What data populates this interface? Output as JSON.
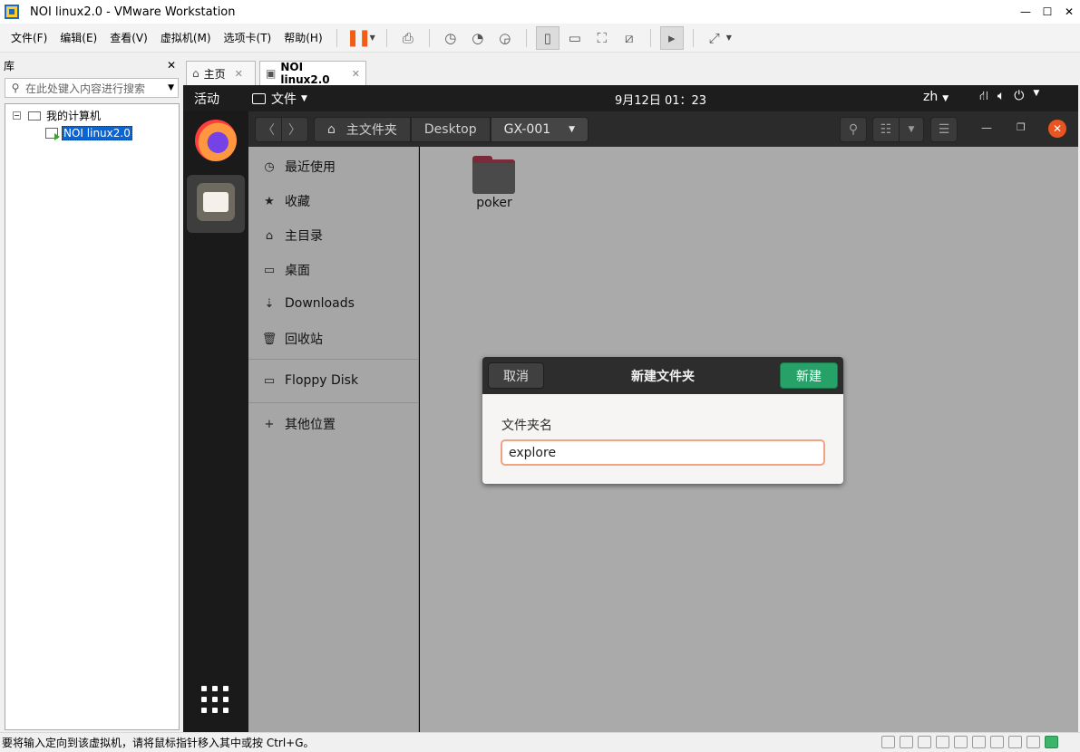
{
  "window": {
    "title": "NOI linux2.0 - VMware Workstation",
    "minimize": "—",
    "maximize": "☐",
    "close": "✕"
  },
  "menubar": {
    "items": [
      "文件(F)",
      "编辑(E)",
      "查看(V)",
      "虚拟机(M)",
      "选项卡(T)",
      "帮助(H)"
    ]
  },
  "library": {
    "title": "库",
    "close": "✕",
    "search_placeholder": "在此处键入内容进行搜索",
    "tree": {
      "root": "我的计算机",
      "vm": "NOI linux2.0",
      "expander": "−"
    }
  },
  "tabs": [
    {
      "label": "主页",
      "close": "✕"
    },
    {
      "label": "NOI linux2.0",
      "close": "✕"
    }
  ],
  "guest": {
    "topbar": {
      "activities": "活动",
      "app_menu": "文件",
      "clock": "9月12日  01：23",
      "lang": "zh"
    },
    "nautilus": {
      "path": [
        "主文件夹",
        "Desktop",
        "GX-001"
      ],
      "sidebar": [
        "最近使用",
        "收藏",
        "主目录",
        "桌面",
        "Downloads",
        "回收站",
        "Floppy Disk",
        "其他位置"
      ],
      "files": [
        {
          "name": "poker",
          "type": "folder"
        }
      ]
    },
    "dialog": {
      "title": "新建文件夹",
      "cancel": "取消",
      "create": "新建",
      "field_label": "文件夹名",
      "field_value": "explore"
    }
  },
  "status": {
    "message": "要将输入定向到该虚拟机，请将鼠标指针移入其中或按 Ctrl+G。"
  },
  "colors": {
    "ubuntu_orange": "#e95420",
    "create_green": "#26a269",
    "selection_blue": "#0a64d2"
  }
}
